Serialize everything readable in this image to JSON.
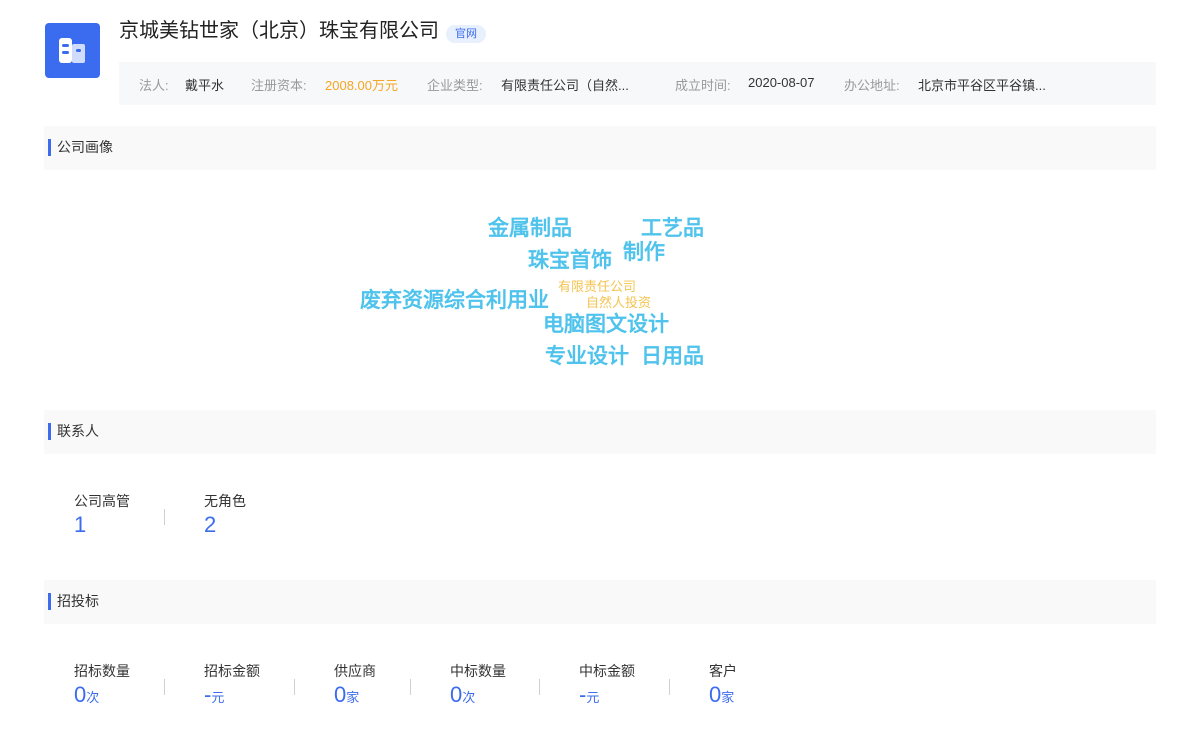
{
  "company": {
    "name": "京城美钻世家（北京）珠宝有限公司",
    "badge": "官网"
  },
  "info": {
    "legal_rep_label": "法人:",
    "legal_rep": "戴平水",
    "capital_label": "注册资本:",
    "capital": "2008.00万元",
    "type_label": "企业类型:",
    "type": "有限责任公司（自然...",
    "founded_label": "成立时间:",
    "founded": "2020-08-07",
    "address_label": "办公地址:",
    "address": "北京市平谷区平谷镇..."
  },
  "sections": {
    "portrait": "公司画像",
    "contacts": "联系人",
    "bidding": "招投标"
  },
  "word_cloud": {
    "blue_words": [
      "金属制品",
      "工艺品",
      "珠宝首饰",
      "制作",
      "废弃资源综合利用业",
      "电脑图文设计",
      "专业设计",
      "日用品"
    ],
    "orange_words": [
      "有限责任公司",
      "自然人投资"
    ],
    "colors": {
      "primary": "#4fc3ec",
      "secondary": "#f5c34f"
    }
  },
  "contacts": [
    {
      "label": "公司高管",
      "value": "1"
    },
    {
      "label": "无角色",
      "value": "2"
    }
  ],
  "bidding": [
    {
      "label": "招标数量",
      "value": "0",
      "unit": "次"
    },
    {
      "label": "招标金额",
      "value": "-",
      "unit": "元"
    },
    {
      "label": "供应商",
      "value": "0",
      "unit": "家"
    },
    {
      "label": "中标数量",
      "value": "0",
      "unit": "次"
    },
    {
      "label": "中标金额",
      "value": "-",
      "unit": "元"
    },
    {
      "label": "客户",
      "value": "0",
      "unit": "家"
    }
  ],
  "theme": {
    "accent": "#3b6cf0",
    "highlight": "#f5a623"
  }
}
